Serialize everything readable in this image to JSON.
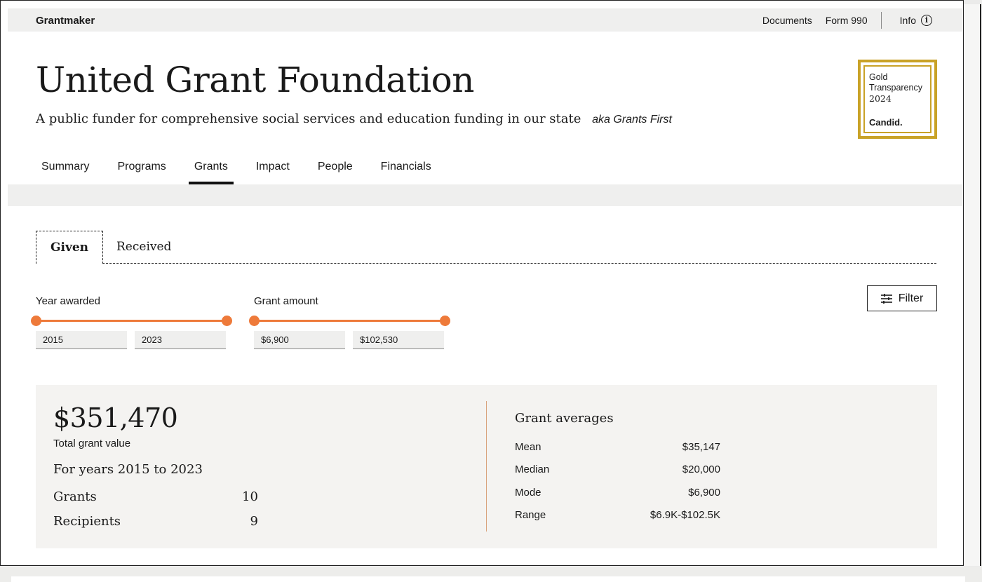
{
  "header": {
    "brand": "Grantmaker",
    "links": [
      "Documents",
      "Form 990"
    ],
    "info_label": "Info"
  },
  "org": {
    "name": "United Grant Foundation",
    "tagline": "A public funder for comprehensive social services and education funding in our state",
    "aka": "aka Grants First"
  },
  "seal": {
    "line1": "Gold",
    "line2": "Transparency",
    "year": "2024",
    "org": "Candid."
  },
  "tabs": [
    "Summary",
    "Programs",
    "Grants",
    "Impact",
    "People",
    "Financials"
  ],
  "active_tab": "Grants",
  "subtabs": {
    "given": "Given",
    "received": "Received"
  },
  "filters": {
    "year": {
      "label": "Year awarded",
      "min": "2015",
      "max": "2023"
    },
    "amount": {
      "label": "Grant amount",
      "min": "$6,900",
      "max": "$102,530"
    },
    "filter_button": "Filter"
  },
  "summary": {
    "total_value": "$351,470",
    "total_label": "Total grant value",
    "years_text": "For years 2015 to 2023",
    "grants_label": "Grants",
    "grants_value": "10",
    "recipients_label": "Recipients",
    "recipients_value": "9"
  },
  "averages": {
    "title": "Grant averages",
    "rows": [
      {
        "label": "Mean",
        "value": "$35,147"
      },
      {
        "label": "Median",
        "value": "$20,000"
      },
      {
        "label": "Mode",
        "value": "$6,900"
      },
      {
        "label": "Range",
        "value": "$6.9K-$102.5K"
      }
    ]
  },
  "colors": {
    "accent": "#ee7a3a",
    "seal_gold": "#c9a227",
    "panel_bg": "#f4f3f1"
  }
}
